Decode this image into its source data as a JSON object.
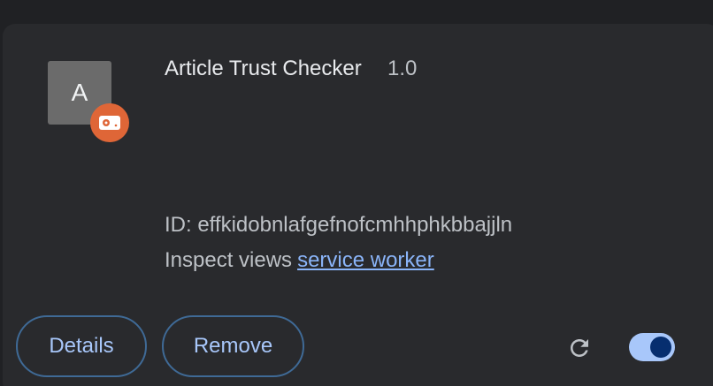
{
  "extension": {
    "icon_letter": "A",
    "source_badge_icon": "unpacked-extension-icon",
    "name": "Article Trust Checker",
    "version": "1.0",
    "id_text": "ID: effkidobnlafgefnofcmhhphkbbajjln",
    "inspect_label": "Inspect views",
    "inspect_link": "service worker",
    "enabled": true
  },
  "actions": {
    "details_label": "Details",
    "remove_label": "Remove",
    "reload_icon": "reload-icon"
  },
  "colors": {
    "background": "#202124",
    "card": "#292a2d",
    "accent": "#a8c7fa",
    "badge": "#df6637"
  }
}
